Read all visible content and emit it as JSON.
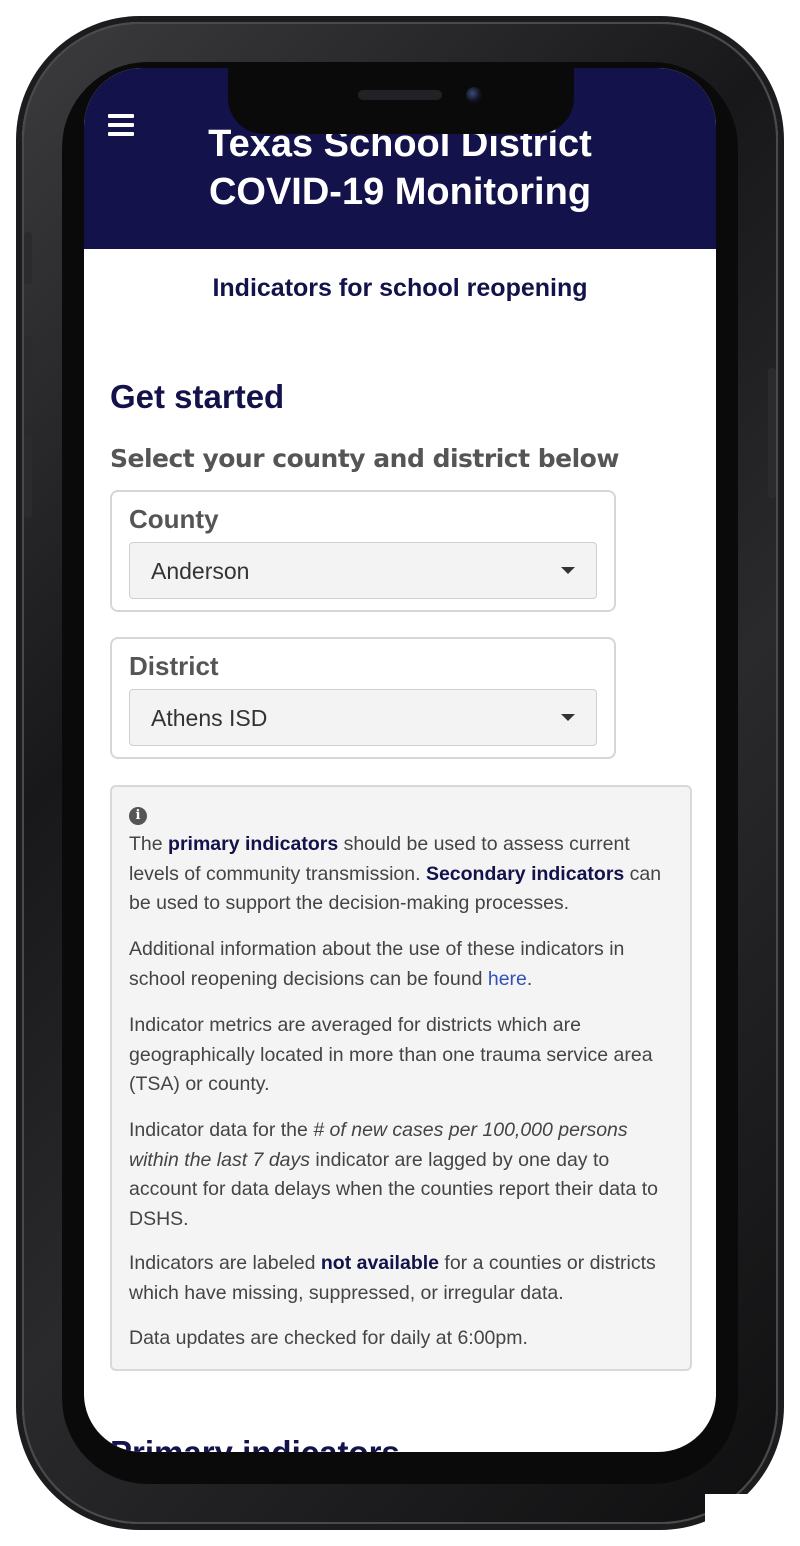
{
  "header": {
    "title_line1": "Texas School District",
    "title_line2": "COVID-19 Monitoring",
    "menu_icon": "hamburger-menu-icon",
    "background_color": "#13124a"
  },
  "page": {
    "subtitle": "Indicators for school reopening",
    "section_title": "Get started",
    "select_prompt": "Select your county and district below"
  },
  "county": {
    "label": "County",
    "selected": "Anderson"
  },
  "district": {
    "label": "District",
    "selected": "Athens ISD"
  },
  "info": {
    "icon": "info-icon",
    "p1_pre": "The ",
    "p1_bold1": "primary indicators",
    "p1_mid": " should be used to assess current levels of community transmission. ",
    "p1_bold2": "Secondary indicators",
    "p1_post": " can be used to support the decision-making processes.",
    "p2_pre": "Additional information about the use of these indicators in school reopening decisions can be found ",
    "p2_link": "here",
    "p2_post": ".",
    "p3": "Indicator metrics are averaged for districts which are geographically located in more than one trauma service area (TSA) or county.",
    "p4_pre": "Indicator data for the ",
    "p4_italic": "# of new cases per 100,000 persons within the last 7 days",
    "p4_post": " indicator are lagged by one day to account for data delays when the counties report their data to DSHS.",
    "p5_pre": "Indicators are labeled ",
    "p5_bold": "not available",
    "p5_post": " for a counties or districts which have missing, suppressed, or irregular data.",
    "p6": "Data updates are checked for daily at 6:00pm."
  },
  "next_section_title": "Primary indicators"
}
